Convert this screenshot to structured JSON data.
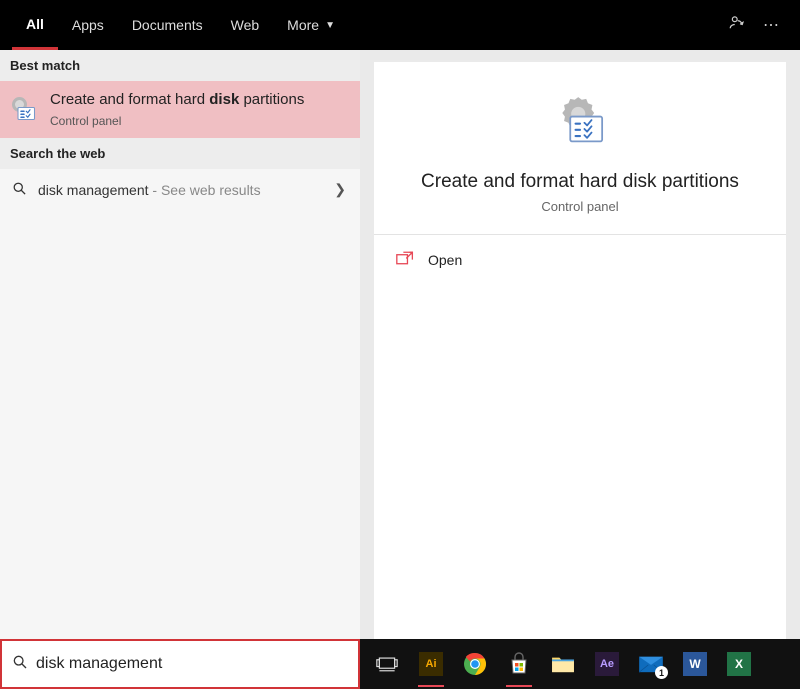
{
  "tabs": {
    "all": "All",
    "apps": "Apps",
    "documents": "Documents",
    "web": "Web",
    "more": "More"
  },
  "left": {
    "best_match_header": "Best match",
    "best_match": {
      "title_pre": "Create and format hard ",
      "title_bold": "disk",
      "title_post": " partitions",
      "subtitle": "Control panel"
    },
    "search_web_header": "Search the web",
    "web_item": {
      "query": "disk management",
      "hint": " - See web results"
    }
  },
  "right": {
    "title": "Create and format hard disk partitions",
    "subtitle": "Control panel",
    "open_label": "Open"
  },
  "search": {
    "value": "disk management"
  },
  "taskbar": {
    "mail_badge": "1"
  }
}
